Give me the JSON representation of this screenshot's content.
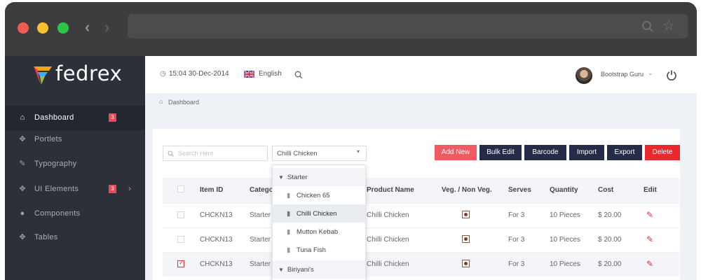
{
  "browser": {
    "dots": [
      "#f15b50",
      "#f6c12d",
      "#2ec44a"
    ],
    "back_icon": "chevron-left-icon",
    "forward_icon": "chevron-right-icon",
    "search_icon": "search-icon",
    "star_icon": "star-icon"
  },
  "logo": {
    "text": "fedrex"
  },
  "sidebar": {
    "items": [
      {
        "label": "Dashboard",
        "icon": "home-icon",
        "badge": "3"
      },
      {
        "label": "Portlets",
        "icon": "puzzle-icon"
      },
      {
        "label": "Typography",
        "icon": "pencil-icon"
      },
      {
        "label": "UI Elements",
        "icon": "puzzle-icon",
        "badge": "3"
      },
      {
        "label": "Components",
        "icon": "drop-icon"
      },
      {
        "label": "Tables",
        "icon": "puzzle-icon"
      }
    ]
  },
  "topbar": {
    "datetime": "15:04 30-Dec-2014",
    "language": "English",
    "user": "Bootstrap Guru"
  },
  "breadcrumb": {
    "label": "Dashboard"
  },
  "toolbar": {
    "search_placeholder": "Search Here",
    "select_value": "Chilli Chicken",
    "buttons": [
      {
        "label": "Add New",
        "color": "#f05a63"
      },
      {
        "label": "Bulk Edit",
        "color": "#262b47"
      },
      {
        "label": "Barcode",
        "color": "#262b47"
      },
      {
        "label": "Import",
        "color": "#262b47"
      },
      {
        "label": "Export",
        "color": "#262b47"
      },
      {
        "label": "Delete",
        "color": "#e8292d"
      }
    ]
  },
  "table": {
    "headers": [
      "Item ID",
      "Catego",
      "Product Name",
      "Veg. / Non Veg.",
      "Serves",
      "Quantity",
      "Cost",
      "Edit"
    ],
    "rows": [
      {
        "id": "CHCKN13",
        "category": "Starter",
        "product": "Chilli Chicken",
        "serves": "For 3",
        "quantity": "10 Pieces",
        "cost": "$ 20.00",
        "checked": false
      },
      {
        "id": "CHCKN13",
        "category": "Starter",
        "product": "Chilli Chicken",
        "serves": "For 3",
        "quantity": "10 Pieces",
        "cost": "$ 20.00",
        "checked": false
      },
      {
        "id": "CHCKN13",
        "category": "Starter",
        "product": "Chilli Chicken",
        "serves": "For 3",
        "quantity": "10 Pieces",
        "cost": "$ 20.00",
        "checked": true
      }
    ]
  },
  "dropdown": {
    "groups": [
      {
        "label": "Starter",
        "items": [
          "Chicken 65",
          "Chilli Chicken",
          "Mutton Kebab",
          "Tuna Fish"
        ]
      },
      {
        "label": "Biriyani's",
        "items": []
      }
    ],
    "selected": "Chilli Chicken"
  }
}
